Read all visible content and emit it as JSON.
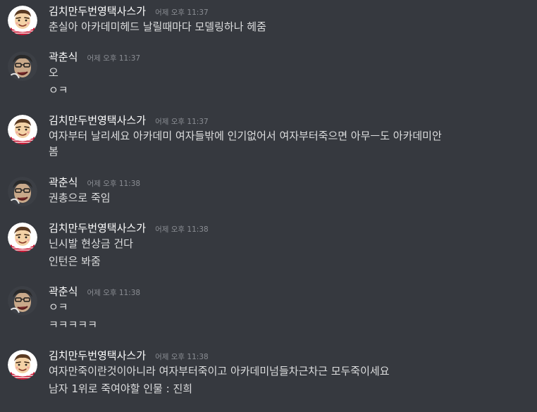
{
  "messages": [
    {
      "username": "김치만두번영택사스가",
      "timestamp": "어제 오후 11:37",
      "avatar_icon": "kimchi-avatar",
      "lines": [
        "춘실아 아카데미헤드 날릴때마다 모델링하나 헤줌"
      ]
    },
    {
      "username": "곽춘식",
      "timestamp": "어제 오후 11:37",
      "avatar_icon": "kwak-avatar",
      "lines": [
        "오",
        "ㅇㅋ"
      ]
    },
    {
      "username": "김치만두번영택사스가",
      "timestamp": "어제 오후 11:37",
      "avatar_icon": "kimchi-avatar",
      "lines": [
        "여자부터 날리세요 아카데미 여자들밖에 인기없어서 여자부터죽으면 아무ㅡ도 아카데미안",
        "봄"
      ]
    },
    {
      "username": "곽춘식",
      "timestamp": "어제 오후 11:38",
      "avatar_icon": "kwak-avatar",
      "lines": [
        "권총으로 죽임"
      ]
    },
    {
      "username": "김치만두번영택사스가",
      "timestamp": "어제 오후 11:38",
      "avatar_icon": "kimchi-avatar",
      "lines": [
        "닌시발 현상금 건다",
        "인턴은 봐줌"
      ]
    },
    {
      "username": "곽춘식",
      "timestamp": "어제 오후 11:38",
      "avatar_icon": "kwak-avatar",
      "lines": [
        "ㅇㅋ",
        "ㅋㅋㅋㅋㅋ"
      ]
    },
    {
      "username": "김치만두번영택사스가",
      "timestamp": "어제 오후 11:38",
      "avatar_icon": "kimchi-avatar",
      "lines": [
        "여자만죽이란것이아니라 여자부터죽이고 아카데미넘들차근차근 모두죽이세요",
        "남자 1위로 죽여야할 인물 : 진희"
      ]
    }
  ],
  "colors": {
    "background": "#36393f",
    "username": "#ffffff",
    "timestamp": "#8a8d93",
    "message_text": "#dcddde"
  }
}
